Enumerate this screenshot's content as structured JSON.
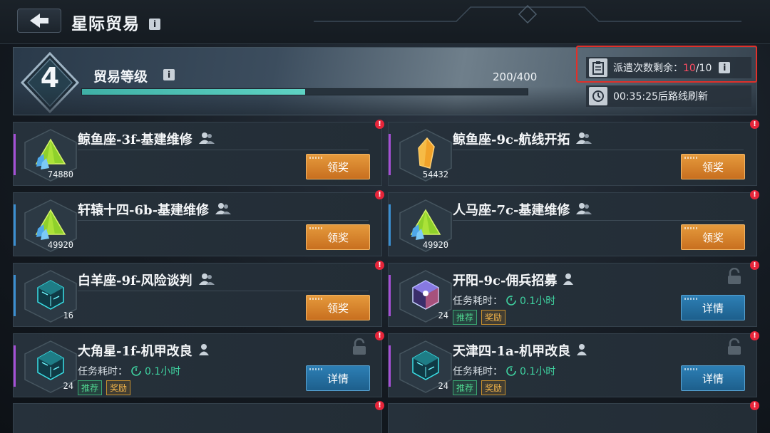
{
  "header": {
    "title": "星际贸易",
    "info_glyph": "i"
  },
  "trade": {
    "level": "4",
    "level_label": "贸易等级",
    "xp": "200/400",
    "xp_progress": 0.5,
    "dispatch_label": "派遣次数剩余：",
    "dispatch_current": "10",
    "dispatch_total": "/10",
    "refresh": "00:35:25后路线刷新"
  },
  "icons": {
    "back": "back-arrow-icon",
    "dispatch": "clipboard-icon",
    "refresh": "clock-icon",
    "team": "team-icon",
    "person": "person-icon",
    "lock": "lock-icon",
    "alert": "alert-icon"
  },
  "colors": {
    "accent_purple": "#a64fd6",
    "accent_blue": "#3b8fd1",
    "claim_button": "#d8822c",
    "detail_button": "#2676a8",
    "dispatch_highlight": "#ff4c62",
    "progress": "#4fc3b4"
  },
  "labels": {
    "claim": "领奖",
    "detail": "详情",
    "duration_label": "任务耗时：",
    "recommend": "推荐",
    "reward": "奖励",
    "alert": "!"
  },
  "missions": [
    {
      "name": "鲸鱼座-3f-基建维修",
      "count": "74880",
      "item": "green-crystal",
      "accent": "purple",
      "action": "claim",
      "party": "team"
    },
    {
      "name": "鲸鱼座-9c-航线开拓",
      "count": "54432",
      "item": "orange-crystal",
      "accent": "purple",
      "action": "claim",
      "party": "team"
    },
    {
      "name": "轩辕十四-6b-基建维修",
      "count": "49920",
      "item": "green-crystal",
      "accent": "blue",
      "action": "claim",
      "party": "team"
    },
    {
      "name": "人马座-7c-基建维修",
      "count": "49920",
      "item": "green-crystal",
      "accent": "blue",
      "action": "claim",
      "party": "team"
    },
    {
      "name": "白羊座-9f-风险谈判",
      "count": "16",
      "item": "cyan-cube",
      "accent": "blue",
      "action": "claim",
      "party": "team"
    },
    {
      "name": "开阳-9c-佣兵招募",
      "count": "24",
      "item": "prism-cube",
      "accent": "purple",
      "action": "detail",
      "party": "person",
      "duration": "0.1小时"
    },
    {
      "name": "大角星-1f-机甲改良",
      "count": "24",
      "item": "cyan-cube",
      "accent": "purple",
      "action": "detail",
      "party": "person",
      "duration": "0.1小时"
    },
    {
      "name": "天津四-1a-机甲改良",
      "count": "24",
      "item": "cyan-cube",
      "accent": "purple",
      "action": "detail",
      "party": "person",
      "duration": "0.1小时"
    }
  ]
}
